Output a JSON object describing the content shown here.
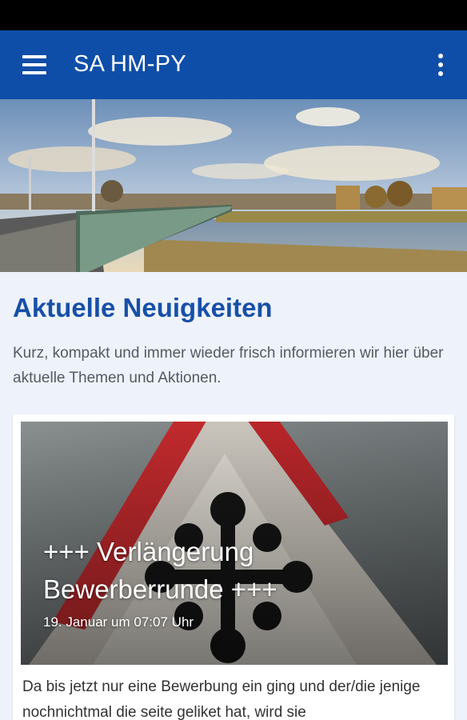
{
  "app_bar": {
    "title": "SA HM-PY",
    "menu_icon": "hamburger-menu-icon",
    "overflow_icon": "more-vert-icon",
    "color": "#0f4ea8"
  },
  "hero": {
    "description_icon": "hero-bridge-photo"
  },
  "news_section": {
    "title": "Aktuelle Neuigkeiten",
    "description": "Kurz, kompakt und immer wieder frisch informieren wir hier über aktuelle Themen und Aktionen.",
    "title_color": "#1750a8"
  },
  "news_card": {
    "title": "+++ Verlängerung Bewerberrunde +++",
    "date": "19. Januar um 07:07 Uhr",
    "excerpt": "Da bis jetzt nur eine Bewerbung ein ging und der/die jenige nochnichtmal die seite geliket hat, wird sie"
  }
}
